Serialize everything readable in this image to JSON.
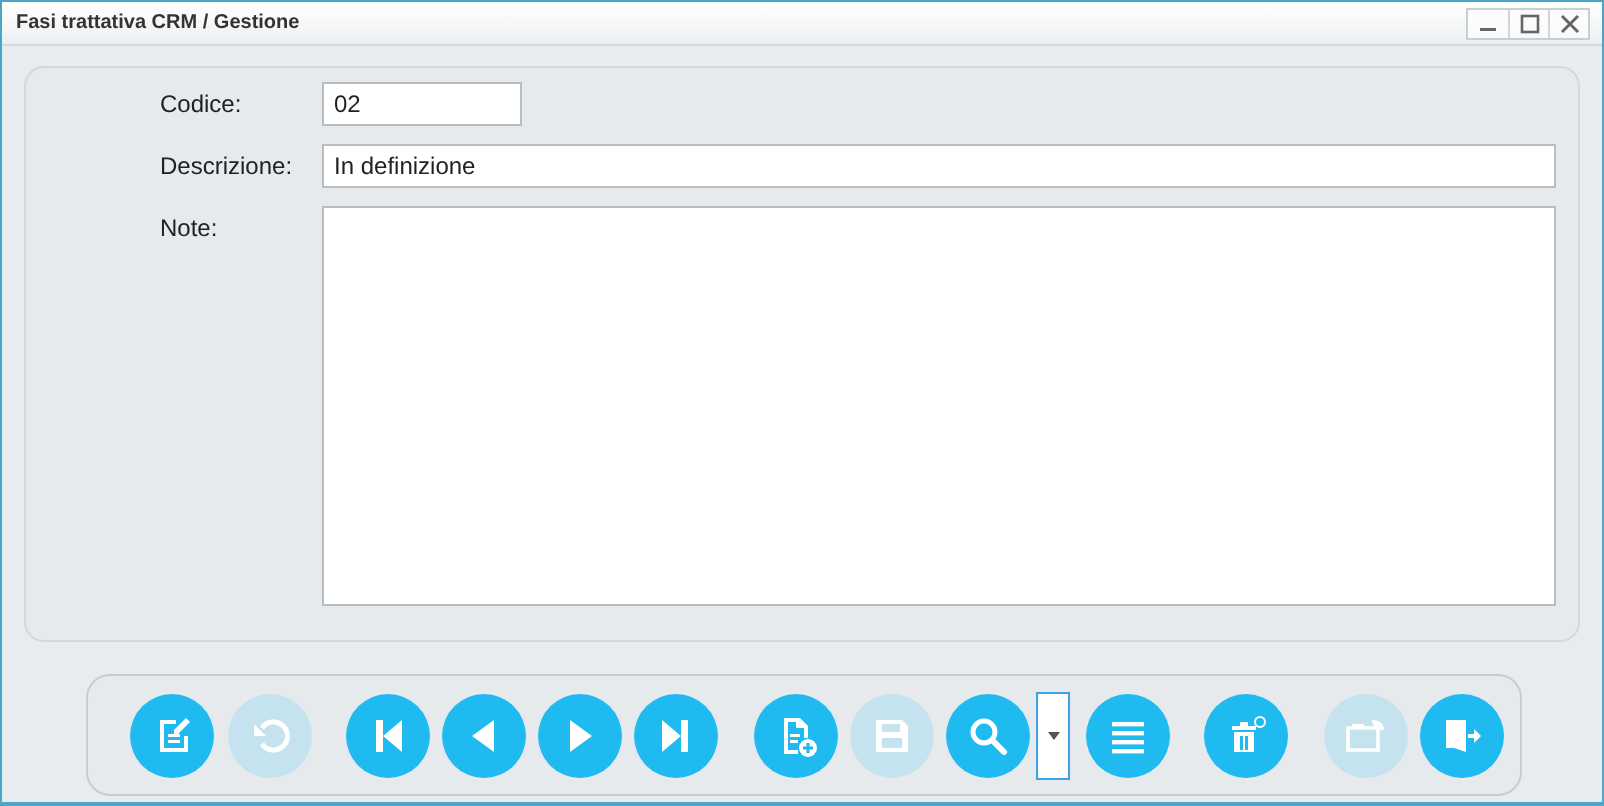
{
  "window": {
    "title": "Fasi trattativa CRM / Gestione"
  },
  "form": {
    "fields": [
      {
        "label": "Codice:",
        "value": "02",
        "kind": "short"
      },
      {
        "label": "Descrizione:",
        "value": "In definizione",
        "kind": "line"
      },
      {
        "label": "Note:",
        "kind": "area"
      }
    ]
  },
  "toolbar": [
    {
      "kind": "edit",
      "disabled": false
    },
    {
      "kind": "undo",
      "disabled": true
    },
    {
      "kind": "first",
      "disabled": false
    },
    {
      "kind": "previous",
      "disabled": false
    },
    {
      "kind": "next",
      "disabled": false
    },
    {
      "kind": "last",
      "disabled": false
    },
    {
      "kind": "new",
      "disabled": false
    },
    {
      "kind": "save",
      "disabled": true
    },
    {
      "kind": "search",
      "disabled": false
    },
    {
      "kind": "dropdown",
      "disabled": false
    },
    {
      "kind": "list",
      "disabled": false
    },
    {
      "kind": "delete",
      "disabled": false
    },
    {
      "kind": "export",
      "disabled": true
    },
    {
      "kind": "exit",
      "disabled": false
    }
  ]
}
